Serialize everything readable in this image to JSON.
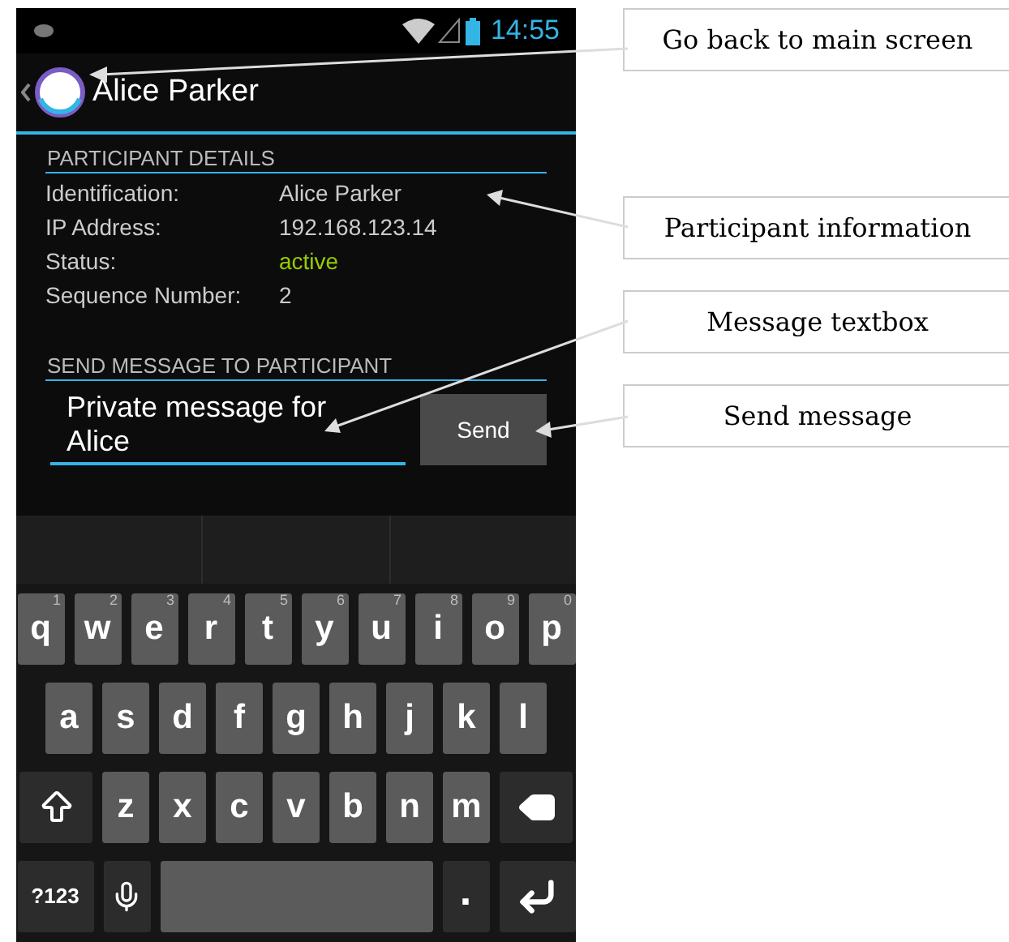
{
  "status_bar": {
    "time": "14:55"
  },
  "action_bar": {
    "title": "Alice Parker"
  },
  "details": {
    "header": "PARTICIPANT DETAILS",
    "rows": [
      {
        "label": "Identification:",
        "value": "Alice Parker",
        "kind": "plain"
      },
      {
        "label": "IP Address:",
        "value": "192.168.123.14",
        "kind": "plain"
      },
      {
        "label": "Status:",
        "value": "active",
        "kind": "status"
      },
      {
        "label": "Sequence Number:",
        "value": "2",
        "kind": "plain"
      }
    ]
  },
  "message": {
    "header": "SEND MESSAGE TO PARTICIPANT",
    "value": "Private message for Alice",
    "send": "Send"
  },
  "keyboard": {
    "rows": [
      {
        "keys": [
          {
            "kind": "letter",
            "label": "q",
            "hint": "1"
          },
          {
            "kind": "letter",
            "label": "w",
            "hint": "2"
          },
          {
            "kind": "letter",
            "label": "e",
            "hint": "3"
          },
          {
            "kind": "letter",
            "label": "r",
            "hint": "4"
          },
          {
            "kind": "letter",
            "label": "t",
            "hint": "5"
          },
          {
            "kind": "letter",
            "label": "y",
            "hint": "6"
          },
          {
            "kind": "letter",
            "label": "u",
            "hint": "7"
          },
          {
            "kind": "letter",
            "label": "i",
            "hint": "8"
          },
          {
            "kind": "letter",
            "label": "o",
            "hint": "9"
          },
          {
            "kind": "letter",
            "label": "p",
            "hint": "0"
          }
        ]
      },
      {
        "keys": [
          {
            "kind": "letter",
            "label": "a"
          },
          {
            "kind": "letter",
            "label": "s"
          },
          {
            "kind": "letter",
            "label": "d"
          },
          {
            "kind": "letter",
            "label": "f"
          },
          {
            "kind": "letter",
            "label": "g"
          },
          {
            "kind": "letter",
            "label": "h"
          },
          {
            "kind": "letter",
            "label": "j"
          },
          {
            "kind": "letter",
            "label": "k"
          },
          {
            "kind": "letter",
            "label": "l"
          }
        ]
      },
      {
        "keys": [
          {
            "kind": "shift"
          },
          {
            "kind": "letter",
            "label": "z"
          },
          {
            "kind": "letter",
            "label": "x"
          },
          {
            "kind": "letter",
            "label": "c"
          },
          {
            "kind": "letter",
            "label": "v"
          },
          {
            "kind": "letter",
            "label": "b"
          },
          {
            "kind": "letter",
            "label": "n"
          },
          {
            "kind": "letter",
            "label": "m"
          },
          {
            "kind": "backspace"
          }
        ]
      },
      {
        "keys": [
          {
            "kind": "symbols",
            "label": "?123"
          },
          {
            "kind": "mic"
          },
          {
            "kind": "space"
          },
          {
            "kind": "period",
            "label": "."
          },
          {
            "kind": "enter"
          }
        ]
      }
    ]
  },
  "callouts": [
    "Go back to main screen",
    "Participant information",
    "Message textbox",
    "Send message"
  ]
}
